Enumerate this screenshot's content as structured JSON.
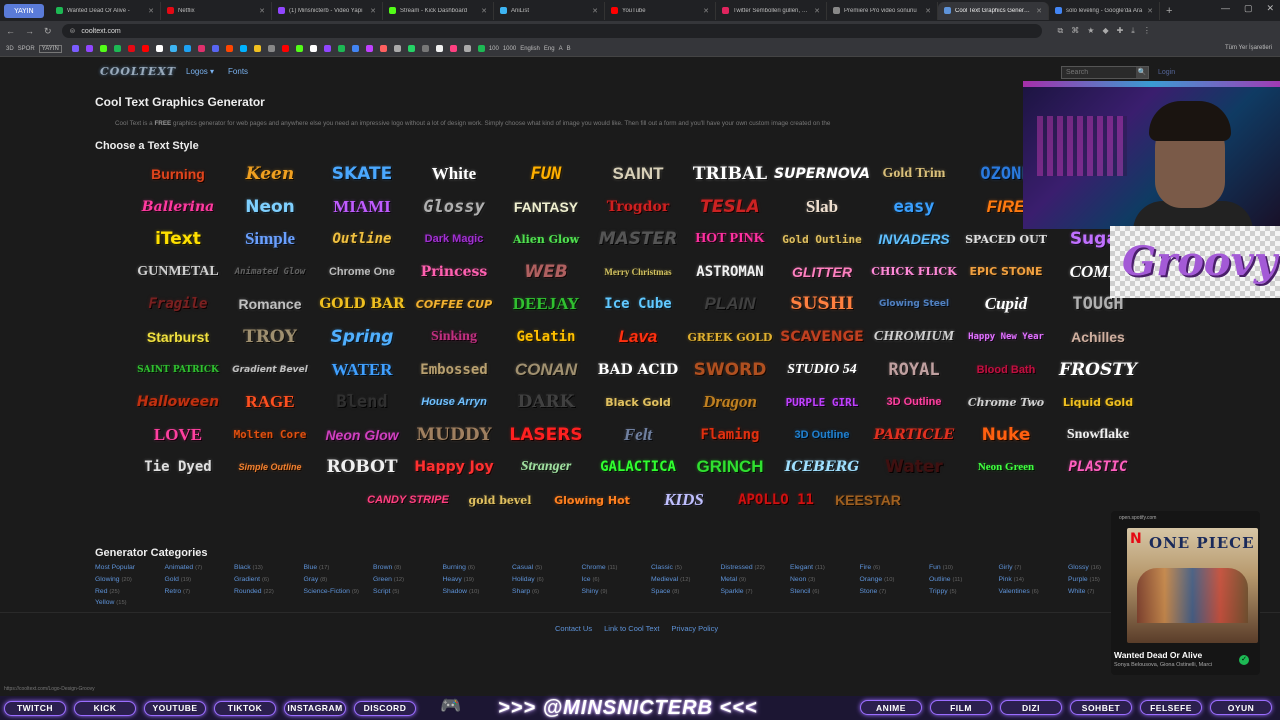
{
  "browser": {
    "profile_label": "YAYIN",
    "tabs": [
      {
        "title": "Wanted Dead Or Alive -",
        "color": "#1db954"
      },
      {
        "title": "Netflix",
        "color": "#e50914"
      },
      {
        "title": "(1) Minsnicterb - Video Yapı",
        "color": "#9146ff"
      },
      {
        "title": "Stream - Kick Dashboard",
        "color": "#53fc18"
      },
      {
        "title": "AniList",
        "color": "#3db4f2"
      },
      {
        "title": "YouTube",
        "color": "#ff0000"
      },
      {
        "title": "Twitter Sembolleri güllen, Em",
        "color": "#e0245e"
      },
      {
        "title": "Premiere Pro video sonunu",
        "color": "#888888"
      },
      {
        "title": "Cool Text Graphics Generato",
        "color": "#5e93d9",
        "active": true
      },
      {
        "title": "solo leveling - Google'da Ara",
        "color": "#4285f4"
      }
    ],
    "url": "cooltext.com",
    "bookmarks_right": "Tüm Yer İşaretleri",
    "bookmark_labels": [
      "3D",
      "SPOR",
      "YAYIN",
      "100",
      "1000",
      "English",
      "Eng",
      "A",
      "B"
    ]
  },
  "site": {
    "logo": "COOLTEXT",
    "nav_logos": "Logos ▾",
    "nav_fonts": "Fonts",
    "search_placeholder": "Search",
    "search_button": "🔍",
    "login": "Login",
    "title": "Cool Text Graphics Generator",
    "intro_prefix": "Cool Text is a ",
    "intro_free": "FREE",
    "intro_suffix": " graphics generator for web pages and anywhere else you need an impressive logo without a lot of design work. Simply choose what kind of image you would like. Then fill out a form and you'll have your own custom image created on the",
    "choose_heading": "Choose a Text Style",
    "categories_heading": "Generator Categories",
    "footer_links": [
      "Contact Us",
      "Link to Cool Text",
      "Privacy Policy"
    ],
    "status_url": "https://cooltext.com/Logo-Design-Groovy"
  },
  "text_styles": [
    [
      {
        "label": "Burning",
        "color": "#e0441c"
      },
      {
        "label": "Keen",
        "color": "#f0a020"
      },
      {
        "label": "SKATE",
        "color": "#4aa8ff"
      },
      {
        "label": "White",
        "color": "#ffffff"
      },
      {
        "label": "FUN",
        "color": "#ffb000"
      },
      {
        "label": "SAINT",
        "color": "#d8d0b8"
      },
      {
        "label": "TRIBAL",
        "color": "#ffffff"
      },
      {
        "label": "SUPERNOVA",
        "color": "#ffffff"
      },
      {
        "label": "Gold Trim",
        "color": "#d9bf7a"
      },
      {
        "label": "OZONE",
        "color": "#2a7adf"
      }
    ],
    [
      {
        "label": "Ballerina",
        "color": "#ff3aa0"
      },
      {
        "label": "Neon",
        "color": "#7fd0ff"
      },
      {
        "label": "MIAMI",
        "color": "#c05cff"
      },
      {
        "label": "Glossy",
        "color": "#b0b0b0"
      },
      {
        "label": "FANTASY",
        "color": "#f0f0d0"
      },
      {
        "label": "Trogdor",
        "color": "#d02020"
      },
      {
        "label": "TESLA",
        "color": "#cc2222"
      },
      {
        "label": "Slab",
        "color": "#f0e0d0"
      },
      {
        "label": "easy",
        "color": "#3aa0ff"
      },
      {
        "label": "FIRE",
        "color": "#ff7a10"
      }
    ],
    [
      {
        "label": "iText",
        "color": "#ffe000"
      },
      {
        "label": "Simple",
        "color": "#6aa0ff"
      },
      {
        "label": "Outline",
        "color": "#f0c040"
      },
      {
        "label": "Dark Magic",
        "color": "#a030d0"
      },
      {
        "label": "Alien Glow",
        "color": "#50e050"
      },
      {
        "label": "MASTER",
        "color": "#555555"
      },
      {
        "label": "HOT PINK",
        "color": "#ff30a0"
      },
      {
        "label": "Gold Outline",
        "color": "#e0c060"
      },
      {
        "label": "INVADERS",
        "color": "#60c0ff"
      },
      {
        "label": "SPACED OUT",
        "color": "#e0e0e0"
      },
      {
        "label": "Sugar",
        "color": "#c070ff"
      }
    ],
    [
      {
        "label": "GUNMETAL",
        "color": "#d0d0d0"
      },
      {
        "label": "Animated Glow",
        "color": "#606060"
      },
      {
        "label": "Chrome One",
        "color": "#bbbbbb"
      },
      {
        "label": "Princess",
        "color": "#ff60b0"
      },
      {
        "label": "WEB",
        "color": "#b06060"
      },
      {
        "label": "Merry Christmas",
        "color": "#d0c060"
      },
      {
        "label": "ASTROMAN",
        "color": "#f0f0f0"
      },
      {
        "label": "GLITTER",
        "color": "#ff80c0"
      },
      {
        "label": "CHICK FLICK",
        "color": "#ff8ad8"
      },
      {
        "label": "EPIC STONE",
        "color": "#f0a040"
      },
      {
        "label": "COMIC",
        "color": "#ffffff"
      }
    ],
    [
      {
        "label": "Fragile",
        "color": "#7a2020"
      },
      {
        "label": "Romance",
        "color": "#c0c0c0"
      },
      {
        "label": "GOLD BAR",
        "color": "#f0c020"
      },
      {
        "label": "COFFEE CUP",
        "color": "#f0b030"
      },
      {
        "label": "DEEJAY",
        "color": "#30c030"
      },
      {
        "label": "Ice Cube",
        "color": "#60c8ff"
      },
      {
        "label": "PLAIN",
        "color": "#404040"
      },
      {
        "label": "SUSHI",
        "color": "#ff8040"
      },
      {
        "label": "Glowing Steel",
        "color": "#5080c0"
      },
      {
        "label": "Cupid",
        "color": "#ffffff"
      },
      {
        "label": "TOUGH",
        "color": "#b0b0b0"
      }
    ],
    [
      {
        "label": "Starburst",
        "color": "#f0e040"
      },
      {
        "label": "TROY",
        "color": "#a09070"
      },
      {
        "label": "Spring",
        "color": "#50b0ff"
      },
      {
        "label": "Sinking",
        "color": "#c03080"
      },
      {
        "label": "Gelatin",
        "color": "#ffc000"
      },
      {
        "label": "Lava",
        "color": "#ff3010"
      },
      {
        "label": "GREEK GOLD",
        "color": "#e0b030"
      },
      {
        "label": "SCAVENGE",
        "color": "#c04020"
      },
      {
        "label": "CHROMIUM",
        "color": "#d0d0d0"
      },
      {
        "label": "Happy New Year",
        "color": "#e070ff"
      },
      {
        "label": "Achilles",
        "color": "#d0b0a0"
      }
    ],
    [
      {
        "label": "SAINT PATRICK",
        "color": "#30c030"
      },
      {
        "label": "Gradient Bevel",
        "color": "#c0c0c0"
      },
      {
        "label": "WATER",
        "color": "#40a0ff"
      },
      {
        "label": "Embossed",
        "color": "#b8a070"
      },
      {
        "label": "CONAN",
        "color": "#a09070"
      },
      {
        "label": "BAD ACID",
        "color": "#ffffff"
      },
      {
        "label": "SWORD",
        "color": "#b05020"
      },
      {
        "label": "STUDIO 54",
        "color": "#ffffff"
      },
      {
        "label": "ROYAL",
        "color": "#c0a0a0"
      },
      {
        "label": "Blood Bath",
        "color": "#c01040"
      },
      {
        "label": "FROSTY",
        "color": "#ffffff"
      }
    ],
    [
      {
        "label": "Halloween",
        "color": "#c03010"
      },
      {
        "label": "RAGE",
        "color": "#ff5020"
      },
      {
        "label": "Blend",
        "color": "#303030"
      },
      {
        "label": "House Arryn",
        "color": "#70c0ff"
      },
      {
        "label": "DARK",
        "color": "#404040"
      },
      {
        "label": "Black Gold",
        "color": "#e0c060"
      },
      {
        "label": "Dragon",
        "color": "#c08020"
      },
      {
        "label": "PURPLE GIRL",
        "color": "#c040ff"
      },
      {
        "label": "3D Outline",
        "color": "#ff40a0"
      },
      {
        "label": "Chrome Two",
        "color": "#d0d0d0"
      },
      {
        "label": "Liquid Gold",
        "color": "#f0c020"
      }
    ],
    [
      {
        "label": "LOVE",
        "color": "#ff40a0"
      },
      {
        "label": "Molten Core",
        "color": "#e05010"
      },
      {
        "label": "Neon Glow",
        "color": "#d040c0"
      },
      {
        "label": "MUDDY",
        "color": "#a08060"
      },
      {
        "label": "LASERS",
        "color": "#ff2020"
      },
      {
        "label": "Felt",
        "color": "#7080a0"
      },
      {
        "label": "Flaming",
        "color": "#e03010"
      },
      {
        "label": "3D Outline",
        "color": "#2080d0"
      },
      {
        "label": "PARTICLE",
        "color": "#e03020"
      },
      {
        "label": "Nuke",
        "color": "#ff6010"
      },
      {
        "label": "Snowflake",
        "color": "#f0f0f0"
      }
    ],
    [
      {
        "label": "Tie Dyed",
        "color": "#e0e0e0"
      },
      {
        "label": "Simple Outline",
        "color": "#f08030"
      },
      {
        "label": "ROBOT",
        "color": "#f0f0f0"
      },
      {
        "label": "Happy Joy",
        "color": "#ff3030"
      },
      {
        "label": "Stranger",
        "color": "#a0e0a0"
      },
      {
        "label": "GALACTICA",
        "color": "#30ff30"
      },
      {
        "label": "GRINCH",
        "color": "#30e030"
      },
      {
        "label": "ICEBERG",
        "color": "#a0e0ff"
      },
      {
        "label": "Water",
        "color": "#401010"
      },
      {
        "label": "Neon Green",
        "color": "#40ff40"
      },
      {
        "label": "PLASTIC",
        "color": "#ff60c0"
      }
    ],
    [
      {
        "label": "CANDY STRIPE",
        "color": "#ff4080"
      },
      {
        "label": "gold bevel",
        "color": "#e0c060"
      },
      {
        "label": "Glowing Hot",
        "color": "#ff8020"
      },
      {
        "label": "KIDS",
        "color": "#c0c0ff"
      },
      {
        "label": "APOLLO 11",
        "color": "#d01010"
      },
      {
        "label": "KEESTAR",
        "color": "#a06020"
      }
    ]
  ],
  "categories": [
    [
      {
        "name": "Most Popular",
        "count": ""
      },
      {
        "name": "Animated",
        "count": "(7)"
      },
      {
        "name": "Black",
        "count": "(13)"
      },
      {
        "name": "Blue",
        "count": "(17)"
      },
      {
        "name": "Brown",
        "count": "(8)"
      },
      {
        "name": "Burning",
        "count": "(6)"
      },
      {
        "name": "Casual",
        "count": "(5)"
      },
      {
        "name": "Chrome",
        "count": "(11)"
      },
      {
        "name": "Classic",
        "count": "(5)"
      },
      {
        "name": "Distressed",
        "count": "(22)"
      },
      {
        "name": "Elegant",
        "count": "(11)"
      },
      {
        "name": "Fire",
        "count": "(6)"
      },
      {
        "name": "Fun",
        "count": "(10)"
      },
      {
        "name": "Girly",
        "count": "(7)"
      },
      {
        "name": "Glossy",
        "count": "(16)"
      }
    ],
    [
      {
        "name": "Glowing",
        "count": "(20)"
      },
      {
        "name": "Gold",
        "count": "(19)"
      },
      {
        "name": "Gradient",
        "count": "(6)"
      },
      {
        "name": "Gray",
        "count": "(8)"
      },
      {
        "name": "Green",
        "count": "(12)"
      },
      {
        "name": "Heavy",
        "count": "(19)"
      },
      {
        "name": "Holiday",
        "count": "(6)"
      },
      {
        "name": "Ice",
        "count": "(6)"
      },
      {
        "name": "Medieval",
        "count": "(12)"
      },
      {
        "name": "Metal",
        "count": "(9)"
      },
      {
        "name": "Neon",
        "count": "(3)"
      },
      {
        "name": "Orange",
        "count": "(10)"
      },
      {
        "name": "Outline",
        "count": "(11)"
      },
      {
        "name": "Pink",
        "count": "(14)"
      },
      {
        "name": "Purple",
        "count": "(15)"
      }
    ],
    [
      {
        "name": "Red",
        "count": "(25)"
      },
      {
        "name": "Retro",
        "count": "(7)"
      },
      {
        "name": "Rounded",
        "count": "(22)"
      },
      {
        "name": "Science-Fiction",
        "count": "(9)"
      },
      {
        "name": "Script",
        "count": "(5)"
      },
      {
        "name": "Shadow",
        "count": "(10)"
      },
      {
        "name": "Sharp",
        "count": "(6)"
      },
      {
        "name": "Shiny",
        "count": "(9)"
      },
      {
        "name": "Space",
        "count": "(8)"
      },
      {
        "name": "Sparkle",
        "count": "(7)"
      },
      {
        "name": "Stencil",
        "count": "(6)"
      },
      {
        "name": "Stone",
        "count": "(7)"
      },
      {
        "name": "Trippy",
        "count": "(5)"
      },
      {
        "name": "Valentines",
        "count": "(6)"
      },
      {
        "name": "White",
        "count": "(7)"
      }
    ],
    [
      {
        "name": "Yellow",
        "count": "(15)"
      }
    ]
  ],
  "overlay": {
    "groovy_text": "Groovy",
    "spotify": {
      "source": "open.spotify.com",
      "art_brand": "N",
      "art_title": "ONE PIECE",
      "track": "Wanted Dead Or Alive",
      "artists": "Sonya Belousova, Giona Ostinelli, Marci",
      "check": "✓"
    }
  },
  "streambar": {
    "left_buttons": [
      "TWITCH",
      "KICK",
      "YOUTUBE",
      "TIKTOK",
      "INSTAGRAM",
      "DISCORD"
    ],
    "handle": ">>> @MINSNICTERB <<<",
    "right_buttons": [
      "ANIME",
      "FILM",
      "DIZI",
      "SOHBET",
      "FELSEFE",
      "OYUN"
    ],
    "accent": "#9b6dff"
  }
}
